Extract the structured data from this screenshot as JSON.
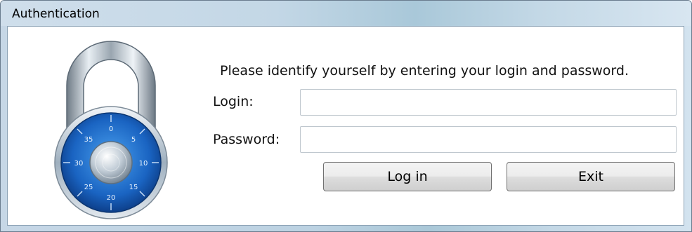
{
  "window": {
    "title": "Authentication"
  },
  "prompt": "Please identify yourself by entering your login and password.",
  "form": {
    "login_label": "Login:",
    "login_value": "",
    "password_label": "Password:",
    "password_value": ""
  },
  "buttons": {
    "login": "Log in",
    "exit": "Exit"
  },
  "icon": {
    "name": "padlock-icon",
    "accent": "#1d63b8"
  },
  "dial_numbers": [
    "0",
    "5",
    "10",
    "15",
    "20",
    "25",
    "30",
    "35"
  ]
}
